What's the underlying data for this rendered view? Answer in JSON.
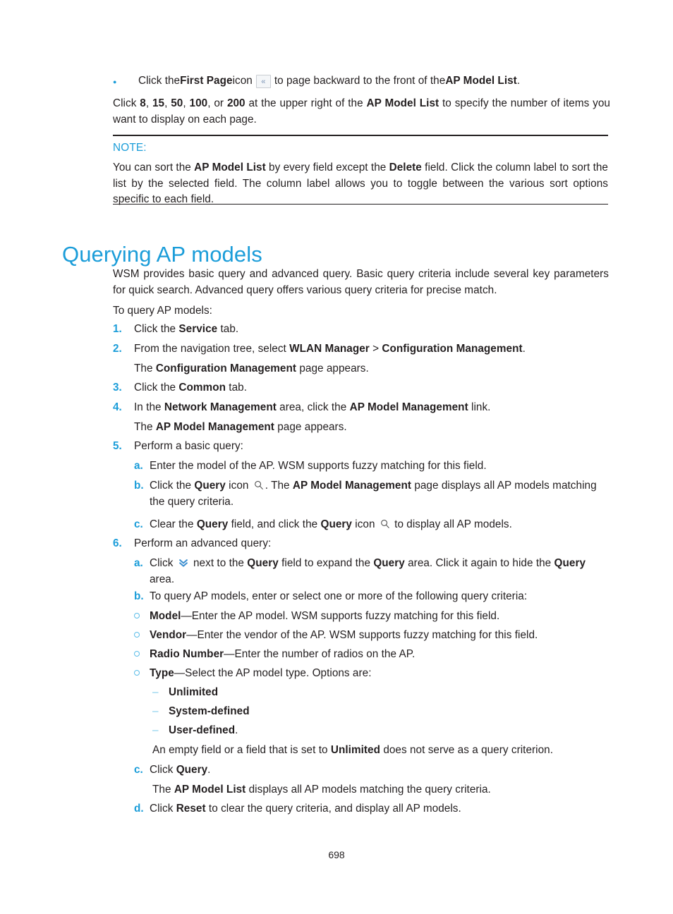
{
  "document": {
    "page_number": "698"
  },
  "top_bullet": {
    "marker": "bullet-dot",
    "text_before": "Click the ",
    "bold_1": "First Page",
    "text_mid": " icon ",
    "icon": "first-page-icon",
    "icon_glyph": "«",
    "text_after": " to page backward to the front of the ",
    "bold_2": "AP Model List",
    "text_end": "."
  },
  "paragraph_page_sizes": {
    "p1": "Click ",
    "n8": "8",
    "sep1": ", ",
    "n15": "15",
    "sep2": ", ",
    "n50": "50",
    "sep3": ", ",
    "n100": "100",
    "sep4": ", or ",
    "n200": "200",
    "p2": " at the upper right of the ",
    "bold_1": "AP Model List",
    "p3": " to specify the number of items you want to display on each page."
  },
  "note": {
    "label": "NOTE:",
    "t1": "You can sort the ",
    "b1": "AP Model List",
    "t2": " by every field except the ",
    "b2": "Delete",
    "t3": " field. Click the column label to sort the list by the selected field. The column label allows you to toggle between the various sort options specific to each field."
  },
  "heading": {
    "title": "Querying AP models"
  },
  "intro": {
    "p1": "WSM provides basic query and advanced query. Basic query criteria include several key parameters for quick search. Advanced query offers various query criteria for precise match.",
    "p2": "To query AP models:"
  },
  "steps": {
    "s1": {
      "num": "1.",
      "t1": "Click the ",
      "b1": "Service",
      "t2": " tab."
    },
    "s2": {
      "num": "2.",
      "t1": "From the navigation tree, select ",
      "b1": "WLAN Manager",
      "t2": " > ",
      "b2": "Configuration Management",
      "t3": ".",
      "cont_t1": "The ",
      "cont_b1": "Configuration Management",
      "cont_t2": " page appears."
    },
    "s3": {
      "num": "3.",
      "t1": "Click the ",
      "b1": "Common",
      "t2": " tab."
    },
    "s4": {
      "num": "4.",
      "t1": "In the ",
      "b1": "Network Management",
      "t2": " area, click the ",
      "b2": "AP Model Management",
      "t3": " link.",
      "cont_t1": "The ",
      "cont_b1": "AP Model Management",
      "cont_t2": " page appears."
    },
    "s5": {
      "num": "5.",
      "t1": "Perform a basic query:",
      "a": {
        "mark": "a.",
        "t1": "Enter the model of the AP. WSM supports fuzzy matching for this field."
      },
      "b": {
        "mark": "b.",
        "t1": "Click the ",
        "b1": "Query",
        "t2": " icon ",
        "icon": "query-search-icon",
        "t3": ". The ",
        "b2": "AP Model Management",
        "t4": " page displays all AP models matching the query criteria."
      },
      "c": {
        "mark": "c.",
        "t1": "Clear the ",
        "b1": "Query",
        "t2": " field, and click the ",
        "b2": "Query",
        "t3": " icon ",
        "icon": "query-search-icon",
        "t4": " to display all AP models."
      }
    },
    "s6": {
      "num": "6.",
      "t1": "Perform an advanced query:",
      "a": {
        "mark": "a.",
        "t1": "Click ",
        "icon": "expand-chevron-icon",
        "t2": " next to the ",
        "b1": "Query",
        "t3": " field to expand the ",
        "b2": "Query",
        "t4": " area. Click it again to hide the ",
        "b3": "Query",
        "t5": " area."
      },
      "b": {
        "mark": "b.",
        "t1": "To query AP models, enter or select one or more of the following query criteria:",
        "criteria": [
          {
            "name": "Model",
            "desc": "—Enter the AP model. WSM supports fuzzy matching for this field."
          },
          {
            "name": "Vendor",
            "desc": "—Enter the vendor of the AP. WSM supports fuzzy matching for this field."
          },
          {
            "name": "Radio Number",
            "desc": "—Enter the number of radios on the AP."
          },
          {
            "name": "Type",
            "desc": "—Select the AP model type. Options are:"
          }
        ],
        "type_options": [
          {
            "label": "Unlimited",
            "tail": ""
          },
          {
            "label": "System-defined",
            "tail": ""
          },
          {
            "label": "User-defined",
            "tail": "."
          }
        ],
        "note_t1": "An empty field or a field that is set to ",
        "note_b1": "Unlimited",
        "note_t2": " does not serve as a query criterion."
      },
      "c": {
        "mark": "c.",
        "t1": "Click ",
        "b1": "Query",
        "t2": ".",
        "cont_t1": "The ",
        "cont_b1": "AP Model List",
        "cont_t2": " displays all AP models matching the query criteria."
      },
      "d": {
        "mark": "d.",
        "t1": "Click ",
        "b1": "Reset",
        "t2": " to clear the query criteria, and display all AP models."
      }
    }
  },
  "colors": {
    "accent_blue": "#1b9dd9",
    "light_blue": "#5bbde8",
    "dash_blue": "#7fcbeb",
    "text": "#231f20"
  }
}
